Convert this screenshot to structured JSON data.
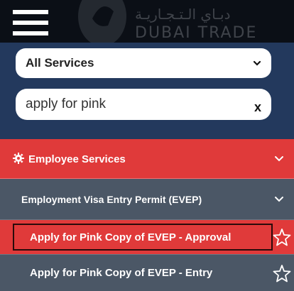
{
  "header": {
    "logo_arabic": "دبـاي الـتـجـاريـة",
    "logo_english": "DUBAI TRADE"
  },
  "search": {
    "service_select_value": "All Services",
    "query_value": "apply for pink",
    "clear_label": "x"
  },
  "menu": {
    "section_label": "Employee Services",
    "subsection_label": "Employment Visa Entry Permit (EVEP)",
    "items": [
      {
        "label": "Apply for Pink Copy of EVEP - Approval",
        "active": true
      },
      {
        "label": "Apply for Pink Copy of EVEP - Entry",
        "active": false
      }
    ]
  },
  "colors": {
    "header_bg": "#0b0f16",
    "search_bg": "#23395d",
    "section_red": "#e03a3a",
    "subsection_gray": "#4b5766"
  },
  "icons": [
    "hamburger-icon",
    "chevron-down-icon",
    "gear-icon",
    "star-outline-icon"
  ]
}
